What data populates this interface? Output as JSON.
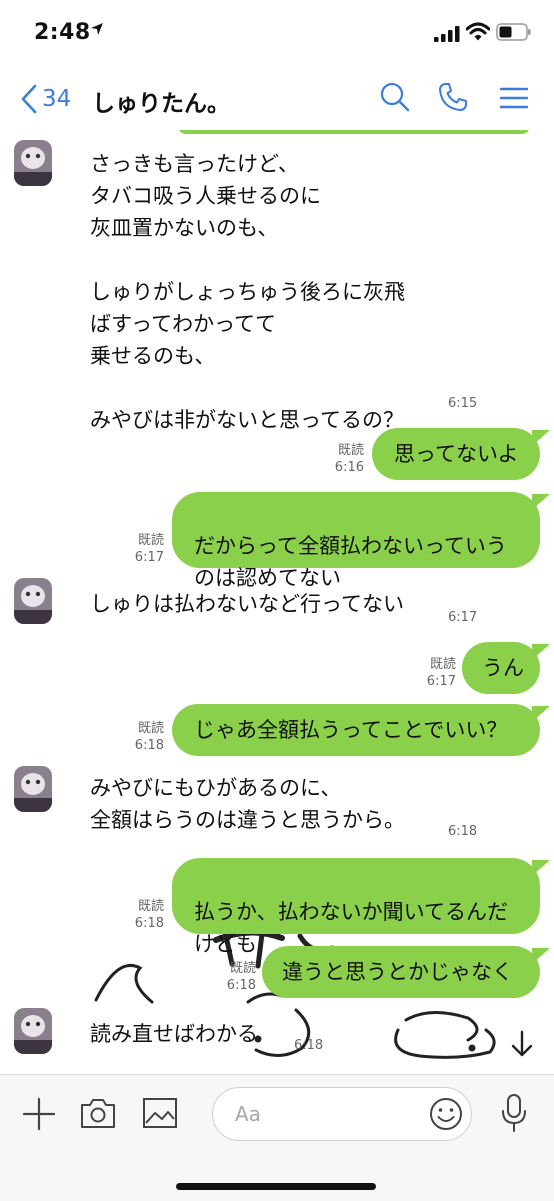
{
  "status_bar": {
    "time": "2:48"
  },
  "header": {
    "back_count": "34",
    "title": "しゅりたん。"
  },
  "messages": [
    {
      "text": "さっきも言ったけど、\nタバコ吸う人乗せるのに\n灰皿置かないのも、\n\nしゅりがしょっちゅう後ろに灰飛\nばすってわかってて\n乗せるのも、\n\nみやびは非がないと思ってるの？",
      "time": "6:15"
    },
    {
      "text": "思ってないよ",
      "read": "既読",
      "time": "6:16"
    },
    {
      "text": "だからって全額払わないっていう\nのは認めてない",
      "read": "既読",
      "time": "6:17"
    },
    {
      "text": "しゅりは払わないなど行ってない",
      "time": "6:17"
    },
    {
      "text": "うん",
      "read": "既読",
      "time": "6:17"
    },
    {
      "text": "じゃあ全額払うってことでいい？",
      "read": "既読",
      "time": "6:18"
    },
    {
      "text": "みやびにもひがあるのに、\n全額はらうのは違うと思うから。",
      "time": "6:18"
    },
    {
      "text": "払うか、払わないか聞いてるんだ\nけども",
      "read": "既読",
      "time": "6:18"
    },
    {
      "text": "違うと思うとかじゃなく",
      "read": "既読",
      "time": "6:18"
    },
    {
      "text": "読み直せばわかる",
      "time": "6:18"
    }
  ],
  "input": {
    "placeholder": "Aa"
  },
  "colors": {
    "bubble_green": "#8bd04b",
    "accent_blue": "#3b7ddd"
  }
}
